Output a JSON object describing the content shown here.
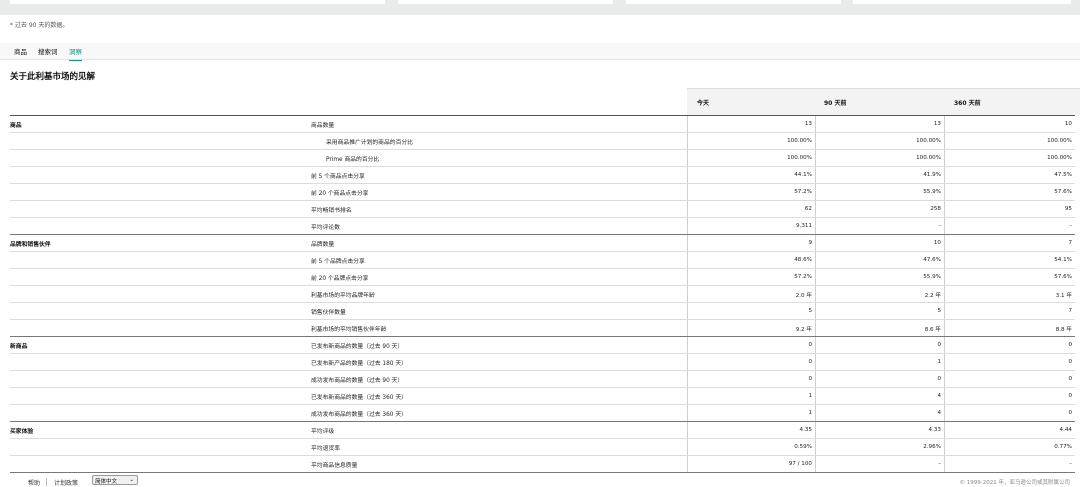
{
  "note": "* 过去 90 天的数据。",
  "tabs": [
    {
      "label": "商品"
    },
    {
      "label": "搜索词"
    },
    {
      "label": "洞察"
    }
  ],
  "heading": "关于此利基市场的见解",
  "columns": [
    "今天",
    "90 天前",
    "360 天前"
  ],
  "rows": [
    {
      "category": "商品",
      "metric": "商品数量",
      "values": [
        "13",
        "13",
        "10"
      ],
      "indent": false
    },
    {
      "category": "",
      "metric": "采用商品推广计划的商品的百分比",
      "values": [
        "100.00%",
        "100.00%",
        "100.00%"
      ],
      "indent": true
    },
    {
      "category": "",
      "metric": "Prime 商品的百分比",
      "values": [
        "100.00%",
        "100.00%",
        "100.00%"
      ],
      "indent": true
    },
    {
      "category": "",
      "metric": "前 5 个商品点击分享",
      "values": [
        "44.1%",
        "41.9%",
        "47.5%"
      ],
      "indent": false
    },
    {
      "category": "",
      "metric": "前 20 个商品点击分享",
      "values": [
        "57.2%",
        "55.9%",
        "57.6%"
      ],
      "indent": false
    },
    {
      "category": "",
      "metric": "平均畅销书排名",
      "values": [
        "62",
        "258",
        "95"
      ],
      "indent": false
    },
    {
      "category": "",
      "metric": "平均评论数",
      "values": [
        "9,311",
        "–",
        "–"
      ],
      "indent": false
    },
    {
      "category": "品牌和销售伙伴",
      "metric": "品牌数量",
      "values": [
        "9",
        "10",
        "7"
      ],
      "indent": false
    },
    {
      "category": "",
      "metric": "前 5 个品牌点击分享",
      "values": [
        "48.6%",
        "47.6%",
        "54.1%"
      ],
      "indent": false
    },
    {
      "category": "",
      "metric": "前 20 个品牌点击分享",
      "values": [
        "57.2%",
        "55.9%",
        "57.6%"
      ],
      "indent": false
    },
    {
      "category": "",
      "metric": "利基市场的平均品牌年龄",
      "values": [
        "2.0 年",
        "2.2 年",
        "3.1 年"
      ],
      "indent": false
    },
    {
      "category": "",
      "metric": "销售伙伴数量",
      "values": [
        "5",
        "5",
        "7"
      ],
      "indent": false
    },
    {
      "category": "",
      "metric": "利基市场的平均销售伙伴年龄",
      "values": [
        "9.2 年",
        "8.6 年",
        "8.8 年"
      ],
      "indent": false
    },
    {
      "category": "新商品",
      "metric": "已发布新商品的数量（过去 90 天）",
      "values": [
        "0",
        "0",
        "0"
      ],
      "indent": false
    },
    {
      "category": "",
      "metric": "已发布新产品的数量（过去 180 天）",
      "values": [
        "0",
        "1",
        "0"
      ],
      "indent": false
    },
    {
      "category": "",
      "metric": "成功发布商品的数量（过去 90 天）",
      "values": [
        "0",
        "0",
        "0"
      ],
      "indent": false
    },
    {
      "category": "",
      "metric": "已发布新商品的数量（过去 360 天）",
      "values": [
        "1",
        "4",
        "0"
      ],
      "indent": false
    },
    {
      "category": "",
      "metric": "成功发布商品的数量（过去 360 天）",
      "values": [
        "1",
        "4",
        "0"
      ],
      "indent": false
    },
    {
      "category": "买家体验",
      "metric": "平均评级",
      "values": [
        "4.35",
        "4.33",
        "4.44"
      ],
      "indent": false
    },
    {
      "category": "",
      "metric": "平均退货率",
      "values": [
        "0.59%",
        "2.96%",
        "0.77%"
      ],
      "indent": false
    },
    {
      "category": "",
      "metric": "平均商品信息质量",
      "values": [
        "97 / 100",
        "–",
        "–"
      ],
      "indent": false
    }
  ],
  "footer": {
    "help": "帮助",
    "policy": "计划政策",
    "language": "简体中文",
    "copyright": "© 1999-2021 年，亚马逊公司或其附属公司"
  }
}
